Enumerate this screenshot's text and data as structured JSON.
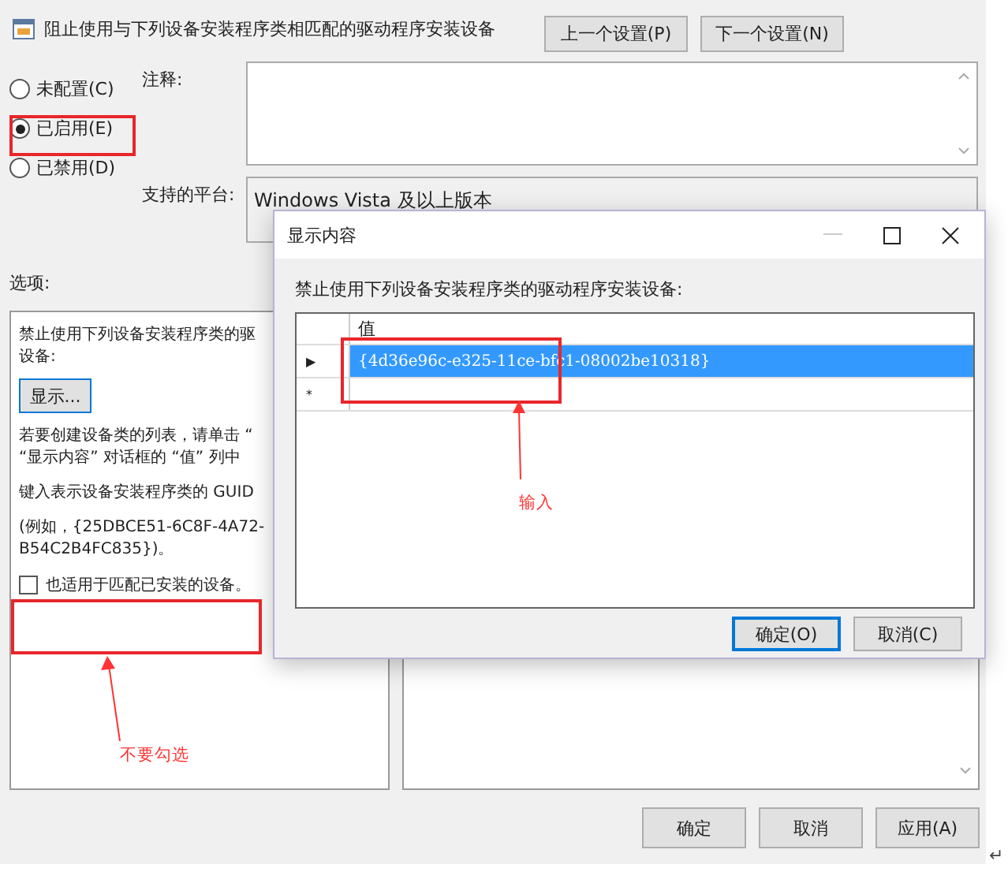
{
  "window": {
    "title": "阻止使用与下列设备安装程序类相匹配的驱动程序安装设备"
  },
  "nav_buttons": [
    "上一个设置(P)",
    "下一个设置(N)"
  ],
  "radios": [
    {
      "label": "未配置(C)",
      "selected": false
    },
    {
      "label": "已启用(E)",
      "selected": true
    },
    {
      "label": "已禁用(D)",
      "selected": false
    }
  ],
  "comment": {
    "label": "注释:"
  },
  "platform": {
    "label": "支持的平台:",
    "value": "Windows Vista 及以上版本"
  },
  "options": {
    "label": "选项:",
    "lines_1": [
      "禁止使用下列设备安装程序类的驱",
      "设备:"
    ],
    "show_button": "显示...",
    "lines_2": [
      "若要创建设备类的列表，请单击 “",
      "“显示内容” 对话框的 “值” 列中"
    ],
    "line_3": "键入表示设备安装程序类的 GUID",
    "lines_4": [
      "(例如，{25DBCE51-6C8F-4A72-",
      "B54C2B4FC835})。"
    ],
    "checkbox": {
      "label": "也适用于匹配已安装的设备。",
      "checked": false
    }
  },
  "footer_buttons": [
    "确定",
    "取消",
    "应用(A)"
  ],
  "dialog": {
    "title": "显示内容",
    "prompt": "禁止使用下列设备安装程序类的驱动程序安装设备:",
    "column": "值",
    "rows": [
      {
        "marker": "▶",
        "value": "{4d36e96c-e325-11ce-bfc1-08002be10318}",
        "selected": true
      },
      {
        "marker": "*",
        "selected": false
      }
    ],
    "buttons": [
      "确定(O)",
      "取消(C)"
    ]
  },
  "annotations": [
    {
      "text": "输入"
    },
    {
      "text": "不要勾选"
    }
  ],
  "return_mark": "↵"
}
